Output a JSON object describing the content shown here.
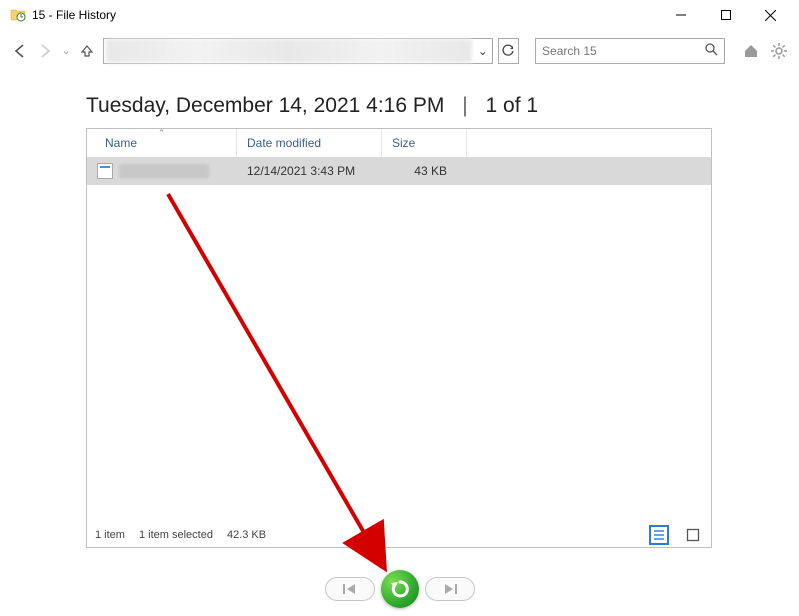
{
  "window": {
    "title": "15 - File History"
  },
  "toolbar": {
    "search_placeholder": "Search 15"
  },
  "heading": {
    "timestamp": "Tuesday, December 14, 2021 4:16 PM",
    "page_indicator": "1 of 1"
  },
  "columns": {
    "name": "Name",
    "date": "Date modified",
    "size": "Size"
  },
  "rows": [
    {
      "name": "",
      "date": "12/14/2021 3:43 PM",
      "size": "43 KB"
    }
  ],
  "status": {
    "count": "1 item",
    "selected": "1 item selected",
    "size": "42.3 KB"
  }
}
